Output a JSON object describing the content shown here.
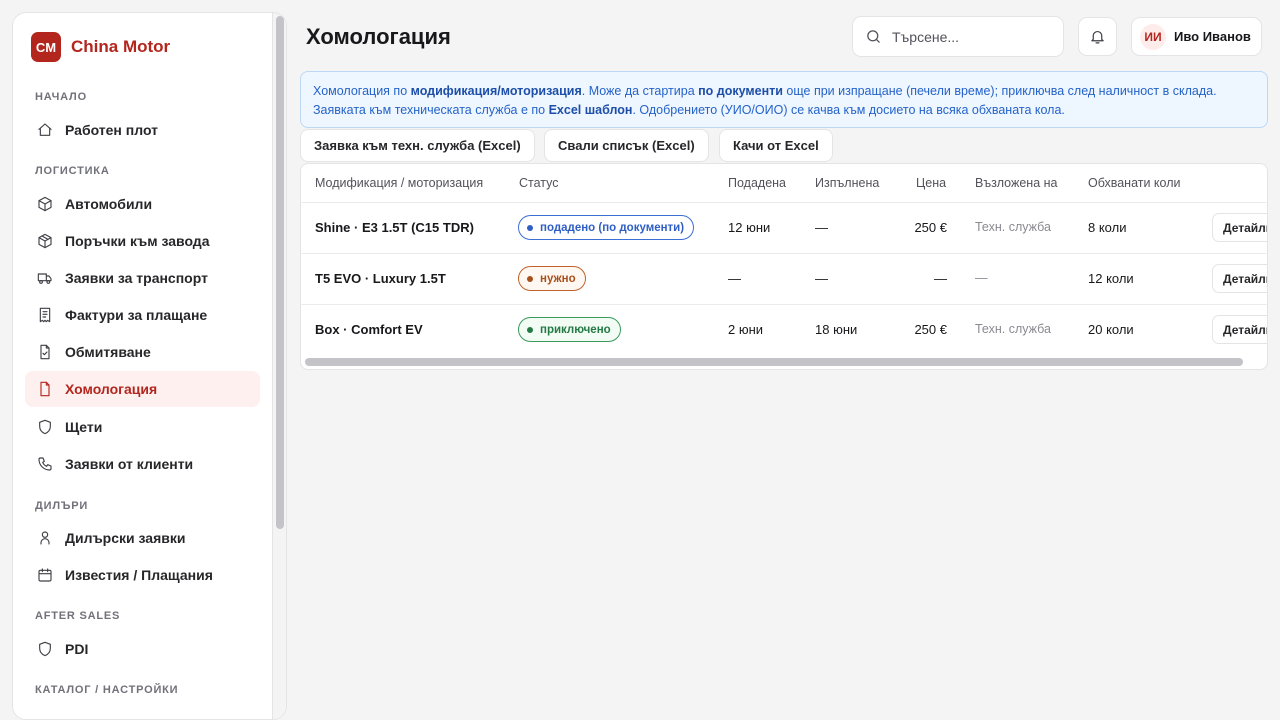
{
  "brand": {
    "logo": "CM",
    "name": "China Motor"
  },
  "sidebar": {
    "sections": [
      {
        "label": "Начало"
      },
      {
        "label": "Логистика"
      },
      {
        "label": "Дилъри"
      },
      {
        "label": "After sales"
      },
      {
        "label": "Каталог / Настройки"
      }
    ],
    "items": [
      {
        "label": "Работен плот",
        "icon": "home-icon"
      },
      {
        "label": "Автомобили",
        "icon": "box-icon"
      },
      {
        "label": "Поръчки към завода",
        "icon": "package-icon"
      },
      {
        "label": "Заявки за транспорт",
        "icon": "truck-icon"
      },
      {
        "label": "Фактури за плащане",
        "icon": "receipt-icon"
      },
      {
        "label": "Обмитяване",
        "icon": "file-check-icon"
      },
      {
        "label": "Хомологация",
        "icon": "file-icon",
        "active": true
      },
      {
        "label": "Щети",
        "icon": "shield-icon"
      },
      {
        "label": "Заявки от клиенти",
        "icon": "phone-icon"
      },
      {
        "label": "Дилърски заявки",
        "icon": "user-icon"
      },
      {
        "label": "Известия / Плащания",
        "icon": "calendar-icon"
      },
      {
        "label": "PDI",
        "icon": "shield-icon"
      }
    ]
  },
  "header": {
    "title": "Хомологация",
    "search_placeholder": "Търсене...",
    "user": {
      "initials": "ИИ",
      "name": "Иво Иванов"
    }
  },
  "banner": {
    "p1": "Хомологация по ",
    "b1": "модификация/моторизация",
    "p2": ". Може да стартира ",
    "b2": "по документи",
    "p3": " още при изпращане (печели време); приключва след наличност в склада. Заявката към техническата служба е по ",
    "b3": "Excel шаблон",
    "p4": ". Одобрението (УИО/ОИО) се качва към досието на всяка обхваната кола."
  },
  "actions": {
    "request": "Заявка към техн. служба (Excel)",
    "download": "Свали списък (Excel)",
    "upload": "Качи от Excel"
  },
  "table": {
    "columns": [
      "Модификация / моторизация",
      "Статус",
      "Подадена",
      "Изпълнена",
      "Цена",
      "Възложена на",
      "Обхванати коли"
    ],
    "rows": [
      {
        "model": "Shine · E3 1.5T (C15 TDR)",
        "status": "подадено (по документи)",
        "submitted": "12 юни",
        "completed": "—",
        "price": "250 €",
        "assignee": "Техн. служба",
        "cars": "8 коли",
        "action": "Детайли"
      },
      {
        "model": "T5 EVO · Luxury 1.5T",
        "status": "нужно",
        "submitted": "—",
        "completed": "—",
        "price": "—",
        "assignee": "—",
        "cars": "12 коли",
        "action": "Детайли"
      },
      {
        "model": "Box · Comfort EV",
        "status": "приключено",
        "submitted": "2 юни",
        "completed": "18 юни",
        "price": "250 €",
        "assignee": "Техн. служба",
        "cars": "20 коли",
        "action": "Детайли"
      }
    ]
  },
  "colors": {
    "brand": "#b3261e",
    "info": "#2563c9",
    "status_blue": "#2f5fc4",
    "status_orange": "#a8501c",
    "status_green": "#237a44"
  }
}
